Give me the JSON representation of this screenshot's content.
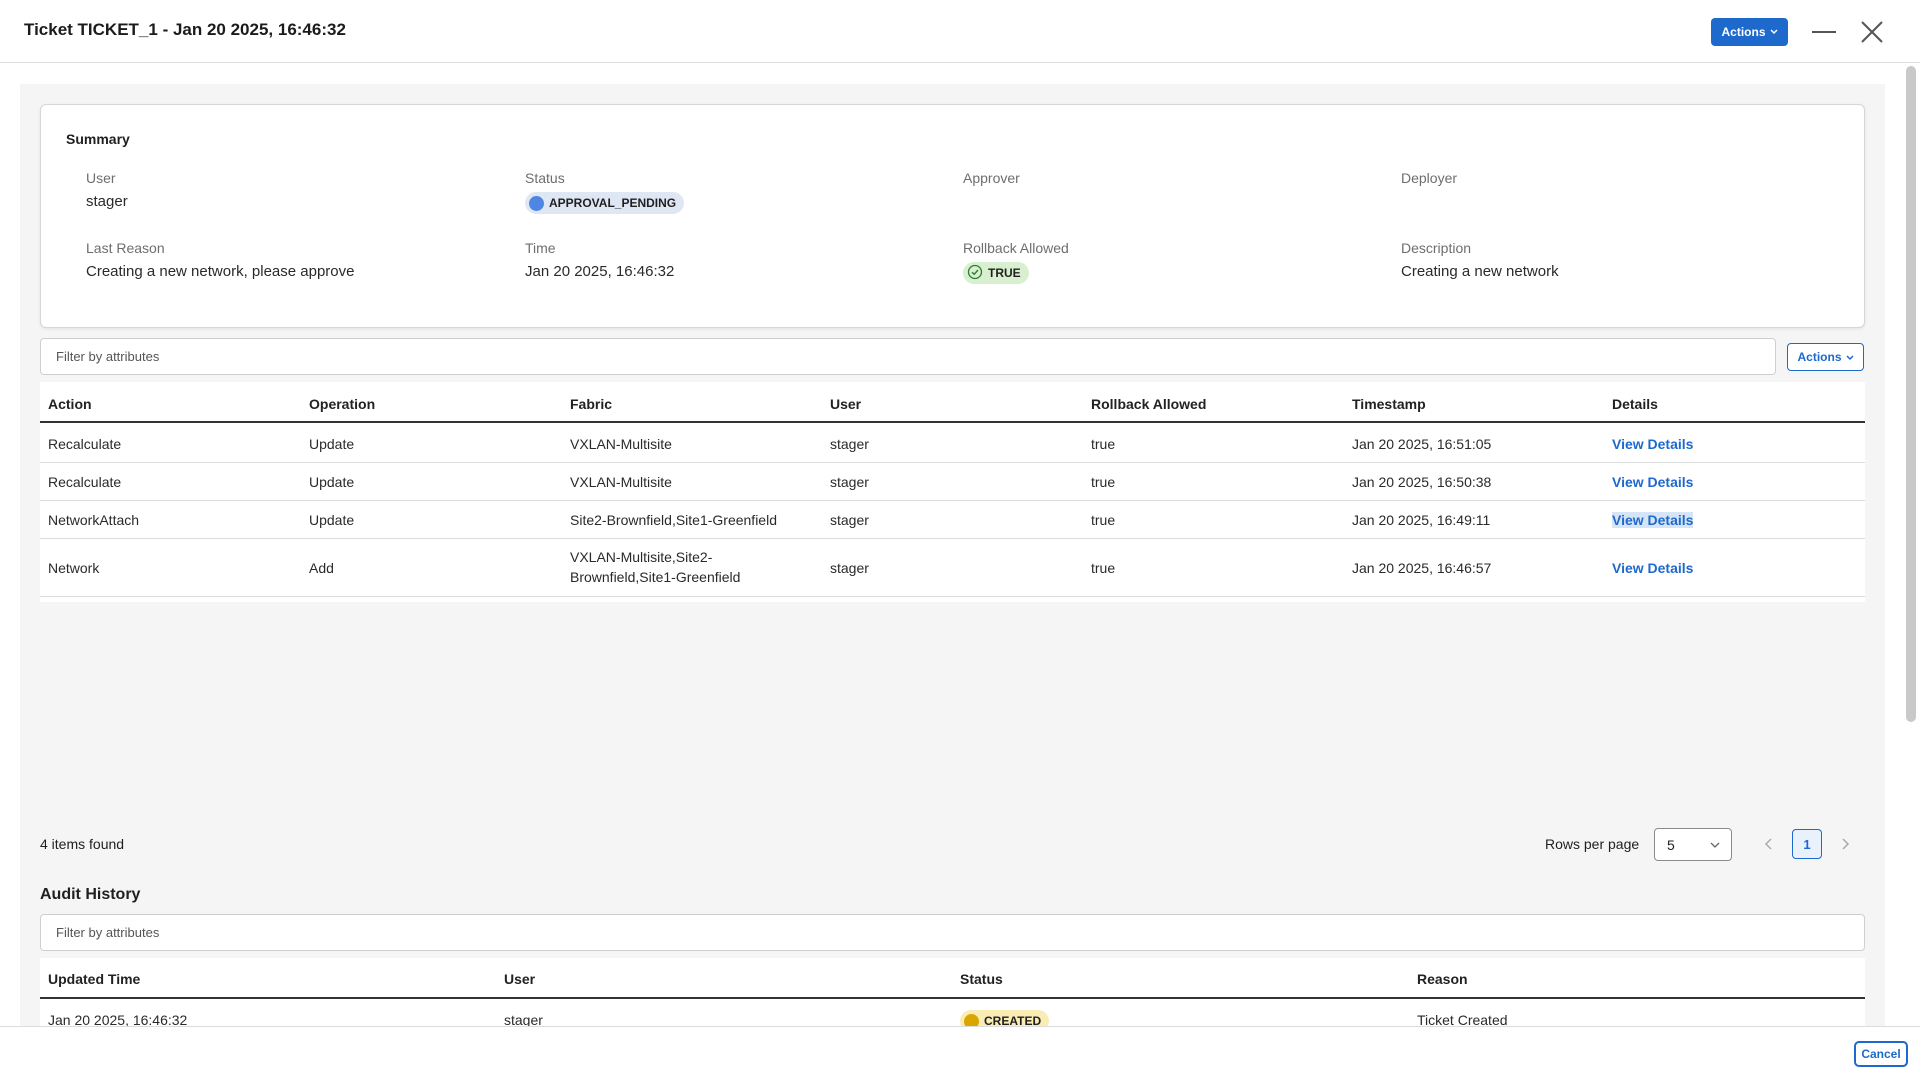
{
  "header": {
    "title": "Ticket TICKET_1 - Jan 20 2025, 16:46:32",
    "actions_label": "Actions"
  },
  "summary": {
    "title": "Summary",
    "user_label": "User",
    "user_value": "stager",
    "status_label": "Status",
    "status_value": "APPROVAL_PENDING",
    "approver_label": "Approver",
    "deployer_label": "Deployer",
    "last_reason_label": "Last Reason",
    "last_reason_value": "Creating a new network, please approve",
    "time_label": "Time",
    "time_value": "Jan 20 2025, 16:46:32",
    "rollback_label": "Rollback Allowed",
    "rollback_value": "TRUE",
    "description_label": "Description",
    "description_value": "Creating a new network"
  },
  "changes": {
    "filter_placeholder": "Filter by attributes",
    "actions_label": "Actions",
    "columns": [
      "Action",
      "Operation",
      "Fabric",
      "User",
      "Rollback Allowed",
      "Timestamp",
      "Details"
    ],
    "rows": [
      {
        "action": "Recalculate",
        "operation": "Update",
        "fabric": "VXLAN-Multisite",
        "user": "stager",
        "rollback": "true",
        "timestamp": "Jan 20 2025, 16:51:05",
        "details": "View Details"
      },
      {
        "action": "Recalculate",
        "operation": "Update",
        "fabric": "VXLAN-Multisite",
        "user": "stager",
        "rollback": "true",
        "timestamp": "Jan 20 2025, 16:50:38",
        "details": "View Details"
      },
      {
        "action": "NetworkAttach",
        "operation": "Update",
        "fabric": "Site2-Brownfield,Site1-Greenfield",
        "user": "stager",
        "rollback": "true",
        "timestamp": "Jan 20 2025, 16:49:11",
        "details": "View Details"
      },
      {
        "action": "Network",
        "operation": "Add",
        "fabric_line1": "VXLAN-Multisite,Site2-",
        "fabric_line2": "Brownfield,Site1-Greenfield",
        "user": "stager",
        "rollback": "true",
        "timestamp": "Jan 20 2025, 16:46:57",
        "details": "View Details"
      }
    ],
    "items_found": "4 items found",
    "rows_per_page_label": "Rows per page",
    "rows_per_page_value": "5",
    "current_page": "1"
  },
  "audit": {
    "title": "Audit History",
    "filter_placeholder": "Filter by attributes",
    "columns": [
      "Updated Time",
      "User",
      "Status",
      "Reason"
    ],
    "rows": [
      {
        "updated_time": "Jan 20 2025, 16:46:32",
        "user": "stager",
        "status": "CREATED",
        "reason": "Ticket Created"
      }
    ]
  },
  "footer": {
    "cancel_label": "Cancel"
  },
  "colors": {
    "accent": "#1d69cc",
    "pending": "#4f86e3",
    "true_badge": "#d8f0cf",
    "created_badge": "#faecb5"
  }
}
